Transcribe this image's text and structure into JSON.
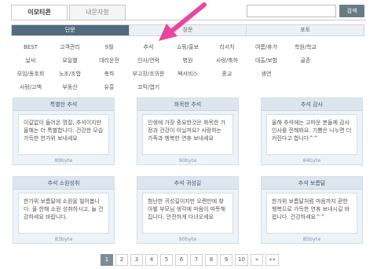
{
  "top_tabs": [
    {
      "label": "이모티콘"
    },
    {
      "label": "내문자함"
    }
  ],
  "search": {
    "value": "",
    "button": "검색"
  },
  "segments": [
    {
      "label": "단문"
    },
    {
      "label": "장문"
    },
    {
      "label": "포토"
    }
  ],
  "categories": [
    [
      "BEST",
      "고객관리",
      "9월",
      "추석",
      "쇼핑/홍보",
      "리서치",
      "여름/휴가",
      "학원/학교"
    ],
    [
      "날씨",
      "요일별",
      "대리운전",
      "인사/연락",
      "병원",
      "사랑/축하",
      "대출/보험",
      "골존"
    ],
    [
      "모임/동호회",
      "노조/조합",
      "축하",
      "부고장/조의문",
      "택서비스",
      "종교",
      "생연"
    ],
    [
      "사랑/고백",
      "부동산",
      "유흥",
      "코믹/엽기"
    ]
  ],
  "cards": [
    {
      "title": "특별한 추석",
      "text": "이갈없이 들어온 명절, 추석이지만 올해는 더 특별합니다. 건강한 모습 가득한 한가위 보내세요",
      "bytes": "89byte"
    },
    {
      "title": "화목한 추석",
      "text": "인생에 가장 중요한것은 화목한 가정과 건강이 아닐까요? 사랑하는 가족과 행복한 연휴 보내세요",
      "bytes": "90byte"
    },
    {
      "title": "추석 감사",
      "text": "올해 추석에는 고마운 분들께 감사 인사를 전해봐요. 기쁨은 나누면 더 커진다고 합니다^^",
      "bytes": "84byte"
    },
    {
      "title": "추석 소원성취",
      "text": "한가위 보름달에 소원을 빌어봅니다. 올 한해 소원 성취하시고, 늘 건강하세요 바랍니다.",
      "bytes": "83byte"
    },
    {
      "title": "추석 귀성길",
      "text": "험난한 귀성길이지만 오랜만에 찾아뵐 부모님 생각에 마음이 따뜻해집니다. 안전하게 다녀오세요",
      "bytes": "90byte"
    },
    {
      "title": "추석 보름달",
      "text": "한가위 보름달처럼 마음까지 환한 행복으로 가득한 연휴 보내시길 바랍니다. 건강하세요^^",
      "bytes": "85byte"
    }
  ],
  "pagination": [
    "1",
    "2",
    "3",
    "4",
    "5",
    "6",
    "7",
    "8",
    "9",
    "10",
    "»",
    "»»"
  ],
  "colors": {
    "accent": "#536b7f",
    "arrow": "#e8479d",
    "card_bg": "#eef3f8"
  }
}
